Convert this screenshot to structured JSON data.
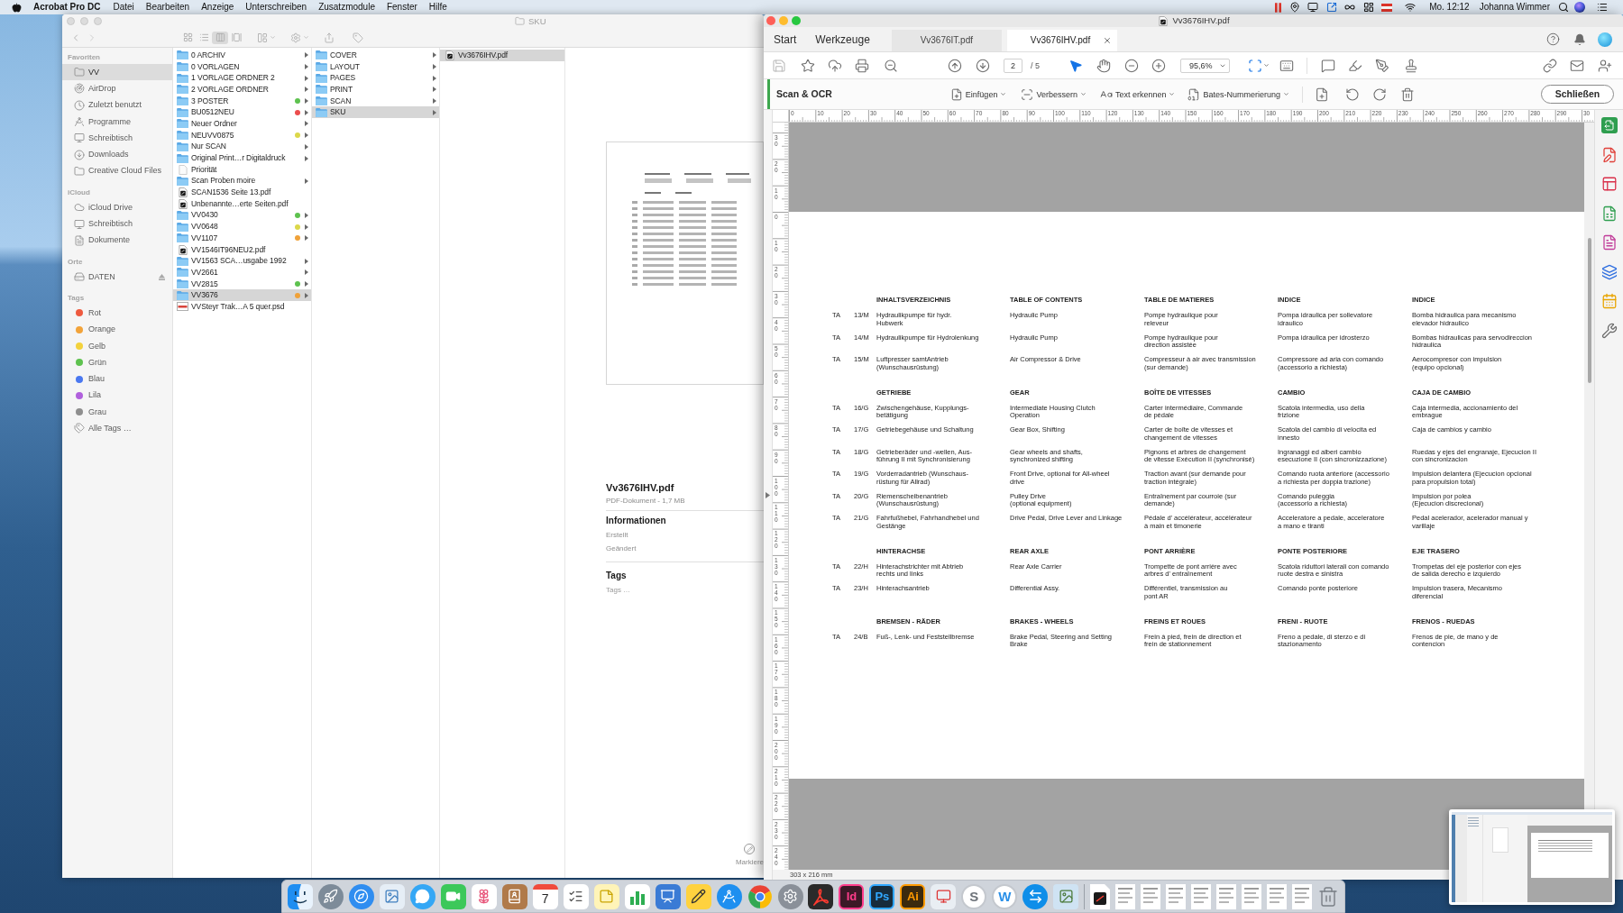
{
  "menu_bar": {
    "app_name": "Acrobat Pro DC",
    "menus": [
      "Datei",
      "Bearbeiten",
      "Anzeige",
      "Unterschreiben",
      "Zusatzmodule",
      "Fenster",
      "Hilfe"
    ],
    "clock": "Mo. 12:12",
    "user": "Johanna Wimmer"
  },
  "finder": {
    "title": "SKU",
    "view_modes": [
      {
        "kind": "icons",
        "selected": false
      },
      {
        "kind": "list",
        "selected": false
      },
      {
        "kind": "columns",
        "selected": true
      },
      {
        "kind": "gallery",
        "selected": false
      }
    ],
    "sidebar": [
      {
        "heading": "Favoriten",
        "items": [
          {
            "label": "VV",
            "kind": "folder",
            "selected": true
          },
          {
            "label": "AirDrop",
            "kind": "airdrop",
            "selected": false
          },
          {
            "label": "Zuletzt benutzt",
            "kind": "recent",
            "selected": false
          },
          {
            "label": "Programme",
            "kind": "apps",
            "selected": false
          },
          {
            "label": "Schreibtisch",
            "kind": "desktop",
            "selected": false
          },
          {
            "label": "Downloads",
            "kind": "downloads",
            "selected": false
          },
          {
            "label": "Creative Cloud Files",
            "kind": "folder",
            "selected": false
          }
        ]
      },
      {
        "heading": "iCloud",
        "items": [
          {
            "label": "iCloud Drive",
            "kind": "cloud",
            "selected": false
          },
          {
            "label": "Schreibtisch",
            "kind": "desktop",
            "selected": false
          },
          {
            "label": "Dokumente",
            "kind": "documents",
            "selected": false
          }
        ]
      },
      {
        "heading": "Orte",
        "items": [
          {
            "label": "DATEN",
            "kind": "disk",
            "selected": false
          }
        ]
      },
      {
        "heading": "Tags",
        "items": [
          {
            "label": "Rot",
            "kind": "tag",
            "color": "#ee5a3f",
            "selected": false
          },
          {
            "label": "Orange",
            "kind": "tag",
            "color": "#f2a33a",
            "selected": false
          },
          {
            "label": "Gelb",
            "kind": "tag",
            "color": "#f3d23c",
            "selected": false
          },
          {
            "label": "Grün",
            "kind": "tag",
            "color": "#5ec24f",
            "selected": false
          },
          {
            "label": "Blau",
            "kind": "tag",
            "color": "#4a78f0",
            "selected": false
          },
          {
            "label": "Lila",
            "kind": "tag",
            "color": "#b060dc",
            "selected": false
          },
          {
            "label": "Grau",
            "kind": "tag",
            "color": "#8e8e8e",
            "selected": false
          },
          {
            "label": "Alle Tags …",
            "kind": "all-tags",
            "selected": false
          }
        ]
      }
    ],
    "columns": [
      [
        {
          "name": "0 ARCHIV",
          "kind": "folder",
          "selected": false
        },
        {
          "name": "0 VORLAGEN",
          "kind": "folder",
          "selected": false
        },
        {
          "name": "1 VORLAGE ORDNER 2",
          "kind": "folder",
          "selected": false
        },
        {
          "name": "2 VORLAGE ORDNER",
          "kind": "folder",
          "selected": false
        },
        {
          "name": "3 POSTER",
          "kind": "folder",
          "color": "#5ec24f",
          "selected": false
        },
        {
          "name": "BU0512NEU",
          "kind": "folder",
          "color": "#ec4d4d",
          "selected": false
        },
        {
          "name": "Neuer Ordner",
          "kind": "folder",
          "selected": false
        },
        {
          "name": "NEUVV0875",
          "kind": "folder",
          "color": "#dcd84a",
          "selected": false
        },
        {
          "name": "Nur SCAN",
          "kind": "folder",
          "selected": false
        },
        {
          "name": "Original Print…r Digitaldruck",
          "kind": "folder",
          "selected": false
        },
        {
          "name": "Priorität",
          "kind": "document",
          "selected": false
        },
        {
          "name": "Scan Proben moire",
          "kind": "folder",
          "selected": false
        },
        {
          "name": "SCAN1536 Seite 13.pdf",
          "kind": "pdf",
          "selected": false
        },
        {
          "name": "Unbenannte…erte Seiten.pdf",
          "kind": "pdf",
          "selected": false
        },
        {
          "name": "VV0430",
          "kind": "folder",
          "color": "#5ec24f",
          "selected": false
        },
        {
          "name": "VV0648",
          "kind": "folder",
          "color": "#dcd84a",
          "selected": false
        },
        {
          "name": "VV1107",
          "kind": "folder",
          "color": "#f0a23a",
          "selected": false
        },
        {
          "name": "VV1546IT96NEU2.pdf",
          "kind": "pdf",
          "selected": false
        },
        {
          "name": "VV1563 SCA…usgabe 1992",
          "kind": "folder",
          "selected": false
        },
        {
          "name": "VV2661",
          "kind": "folder",
          "selected": false
        },
        {
          "name": "VV2815",
          "kind": "folder",
          "color": "#5ec24f",
          "selected": false
        },
        {
          "name": "VV3676",
          "kind": "folder",
          "color": "#f0a23a",
          "selected": true
        },
        {
          "name": "VVSteyr Trak…A 5 quer.psd",
          "kind": "psd",
          "selected": false
        }
      ],
      [
        {
          "name": "COVER",
          "kind": "folder",
          "selected": false
        },
        {
          "name": "LAYOUT",
          "kind": "folder",
          "selected": false
        },
        {
          "name": "PAGES",
          "kind": "folder",
          "selected": false
        },
        {
          "name": "PRINT",
          "kind": "folder",
          "selected": false
        },
        {
          "name": "SCAN",
          "kind": "folder",
          "selected": false
        },
        {
          "name": "SKU",
          "kind": "folder",
          "selected": true
        }
      ],
      [
        {
          "name": "Vv3676IHV.pdf",
          "kind": "pdf",
          "selected": true
        }
      ]
    ],
    "preview": {
      "file_name": "Vv3676IHV.pdf",
      "file_info": "PDF-Dokument - 1,7 MB",
      "info_heading": "Informationen",
      "info_rows": [
        "Erstellt",
        "Geändert"
      ],
      "tags_heading": "Tags",
      "tags_placeholder": "Tags …",
      "markup_label": "Markiere"
    }
  },
  "acrobat": {
    "title": "Vv3676IHV.pdf",
    "tabs": [
      {
        "label": "Start",
        "kind": "nav",
        "selected": false
      },
      {
        "label": "Werkzeuge",
        "kind": "nav",
        "selected": false
      },
      {
        "label": "Vv3676IT.pdf",
        "kind": "document",
        "selected": false
      },
      {
        "label": "Vv3676IHV.pdf",
        "kind": "document",
        "selected": true
      }
    ],
    "page_field": {
      "value": "2",
      "total": "/ 5"
    },
    "tools": [
      {
        "kind": "select",
        "selected": true
      },
      {
        "kind": "hand",
        "selected": false
      }
    ],
    "zoom_field": {
      "value": "95,6%"
    },
    "scan_bar": {
      "title": "Scan & OCR",
      "menus": [
        {
          "label": "Einfügen",
          "kind": "insert"
        },
        {
          "label": "Verbessern",
          "kind": "enhance"
        },
        {
          "label": "Text erkennen",
          "kind": "recognize"
        },
        {
          "label": "Bates-Nummerierung",
          "kind": "bates"
        }
      ],
      "close_button": "Schließen"
    },
    "horizontal_ruler": [
      "0",
      "10",
      "20",
      "30",
      "40",
      "50",
      "60",
      "70",
      "80",
      "90",
      "100",
      "110",
      "120",
      "130",
      "140",
      "150",
      "160",
      "170",
      "180",
      "190",
      "200",
      "210",
      "220",
      "230",
      "240",
      "250",
      "260",
      "270",
      "280",
      "290",
      "30"
    ],
    "vertical_ruler": [
      "30",
      "20",
      "10",
      "0",
      "10",
      "20",
      "30",
      "40",
      "50",
      "60",
      "70",
      "80",
      "90",
      "100",
      "110",
      "120",
      "130",
      "140",
      "150",
      "160",
      "170",
      "180",
      "190",
      "200",
      "210",
      "220",
      "230",
      "240"
    ],
    "document": {
      "sections": [
        {
          "headings": [
            "INHALTSVERZEICHNIS",
            "TABLE OF CONTENTS",
            "TABLE DE MATIERES",
            "INDICE",
            "INDICE"
          ],
          "rows": [
            {
              "prefix": "TA",
              "code": "13/M",
              "cells": [
                "Hydraulikpumpe für hydr.\nHubwerk",
                "Hydraulic Pump",
                "Pompe hydraulique pour\nreleveur",
                "Pompa idraulica per sollevatore\nidraulico",
                "Bomba hidraulica para mecanismo\nelevador hidraulico"
              ]
            },
            {
              "prefix": "TA",
              "code": "14/M",
              "cells": [
                "Hydraulikpumpe für Hydrolenkung",
                "Hydraulic Pump",
                "Pompe hydraulique pour\ndirection assistée",
                "Pompa idraulica per idrosterzo",
                "Bombas hidraulicas para servodireccion\nhidraulica"
              ]
            },
            {
              "prefix": "TA",
              "code": "15/M",
              "cells": [
                "Luftpresser samtAntrieb\n(Wunschausrüstung)",
                "Air Compressor & Drive",
                "Compresseur à air avec transmission\n(sur demande)",
                "Compressore ad aria con comando\n(accessorio a richiesta)",
                "Aerocompresor con impulsion\n(equipo opcional)"
              ]
            }
          ]
        },
        {
          "headings": [
            "GETRIEBE",
            "GEAR",
            "BOÎTE DE VITESSES",
            "CAMBIO",
            "CAJA DE CAMBIO"
          ],
          "rows": [
            {
              "prefix": "TA",
              "code": "16/G",
              "cells": [
                "Zwischengehäuse, Kupplungs-\nbetätigung",
                "Intermediate Housing Clutch\nOperation",
                "Carter intermédiaire, Commande\nde pédale",
                "Scatola intermedia, uso della\nfrizione",
                "Caja intermedia, accionamiento del\nembrague"
              ]
            },
            {
              "prefix": "TA",
              "code": "17/G",
              "cells": [
                "Getriebegehäuse und Schaltung",
                "Gear Box, Shifting",
                "Carter de boîte de vitesses et\nchangement de vitesses",
                "Scatola del cambio di velocita ed\ninnesto",
                "Caja de cambios y cambio"
              ]
            },
            {
              "prefix": "TA",
              "code": "18/G",
              "cells": [
                "Getrieberäder und -wellen, Aus-\nführung II mit Synchronisierung",
                "Gear wheels and shafts,\nsynchronized shifting",
                "Pignons et arbres de changement\nde vitesse Exécution II (synchronisé)",
                "Ingranaggi ed alberi cambio\nesecuzione II (con sincronizzazione)",
                "Ruedas y ejes del engranaje, Ejecucion II\ncon sincronizacion"
              ]
            },
            {
              "prefix": "TA",
              "code": "19/G",
              "cells": [
                "Vorderradantrieb (Wunschaus-\nrüstung für Allrad)",
                "Front Drive, optional for All-wheel\ndrive",
                "Traction avant (sur demande pour\ntraction intégrale)",
                "Comando ruota anteriore (accessorio\na richiesta per doppia trazione)",
                "Impulsion delantera (Ejecucion opcional\npara propulsion total)"
              ]
            },
            {
              "prefix": "TA",
              "code": "20/G",
              "cells": [
                "Riemenscheibenantrieb\n(Wunschausrüstung)",
                "Pulley Drive\n(optional equipment)",
                "Entraînement par courroie (sur\ndemande)",
                "Comando puleggia\n(accessorio a richiesta)",
                "Impulsion por polea\n(Ejecucion discrecional)"
              ]
            },
            {
              "prefix": "TA",
              "code": "21/G",
              "cells": [
                "Fahrfußhebel, Fahrhandhebel und\nGestänge",
                "Drive Pedal, Drive Lever and Linkage",
                "Pédale d' accélérateur, accélérateur\nà main et timonerie",
                "Acceleratore a pedale, acceleratore\na mano e tiranti",
                "Pedal acelerador, acelerador manual y\nvarillaje"
              ]
            }
          ]
        },
        {
          "headings": [
            "HINTERACHSE",
            "REAR AXLE",
            "PONT ARRIÈRE",
            "PONTE POSTERIORE",
            "EJE TRASERO"
          ],
          "rows": [
            {
              "prefix": "TA",
              "code": "22/H",
              "cells": [
                "Hinterachstrichter mit Abtrieb\nrechts und links",
                "Rear Axle Carrier",
                "Trompette de pont arrière avec\narbres d' entraînement",
                "Scatola riduttori laterali con comando\nruote destra e sinistra",
                "Trompetas del eje posterior con ejes\nde salida derecho e izquierdo"
              ]
            },
            {
              "prefix": "TA",
              "code": "23/H",
              "cells": [
                "Hinterachsantrieb",
                "Differential Assy.",
                "Différentiel, transmission au\npont AR",
                "Comando ponte posteriore",
                "Impulsion trasera, Mecanismo\ndiferencial"
              ]
            }
          ]
        },
        {
          "headings": [
            "BREMSEN - RÄDER",
            "BRAKES - WHEELS",
            "FREINS ET ROUES",
            "FRENI - RUOTE",
            "FRENOS - RUEDAS"
          ],
          "rows": [
            {
              "prefix": "TA",
              "code": "24/B",
              "cells": [
                "Fuß-, Lenk- und Feststellbremse",
                "Brake Pedal, Steering and Setting\nBrake",
                "Frein à pied, frein de direction et\nfrein de stationnement",
                "Freno a pedale, di sterzo e di\nstazionamento",
                "Frenos de pie, de mano y de\ncontencion"
              ]
            }
          ]
        }
      ]
    },
    "status_bar": "303 x 216 mm"
  },
  "dock": {
    "items": [
      {
        "kind": "face"
      },
      {
        "kind": "rocket"
      },
      {
        "kind": "compass"
      },
      {
        "kind": "picture"
      },
      {
        "kind": "chat"
      },
      {
        "kind": "video"
      },
      {
        "kind": "flower"
      },
      {
        "kind": "book"
      },
      {
        "kind": "calendar",
        "label": "7"
      },
      {
        "kind": "checklist"
      },
      {
        "kind": "notepad"
      },
      {
        "kind": "chart"
      },
      {
        "kind": "presentation"
      },
      {
        "kind": "pencil"
      },
      {
        "kind": "store"
      },
      {
        "kind": "tricolor"
      },
      {
        "kind": "gear"
      },
      {
        "kind": "dark-app"
      },
      {
        "kind": "letter-tile",
        "label": "Id",
        "color": "#ff3d8b"
      },
      {
        "kind": "letter-tile",
        "label": "Ps",
        "color": "#31a8ff"
      },
      {
        "kind": "letter-tile",
        "label": "Ai",
        "color": "#ff9a00"
      },
      {
        "kind": "monitor"
      },
      {
        "kind": "letter-circle",
        "label": "S",
        "color": "#6f747b"
      },
      {
        "kind": "letter-circle",
        "label": "W",
        "color": "#2a90e8"
      },
      {
        "kind": "arrows-circle"
      },
      {
        "kind": "landscape"
      },
      {
        "kind": "separator"
      },
      {
        "kind": "pdf-document"
      },
      {
        "kind": "document"
      },
      {
        "kind": "document"
      },
      {
        "kind": "document"
      },
      {
        "kind": "document"
      },
      {
        "kind": "document"
      },
      {
        "kind": "document"
      },
      {
        "kind": "document"
      },
      {
        "kind": "document"
      },
      {
        "kind": "trash"
      }
    ]
  }
}
